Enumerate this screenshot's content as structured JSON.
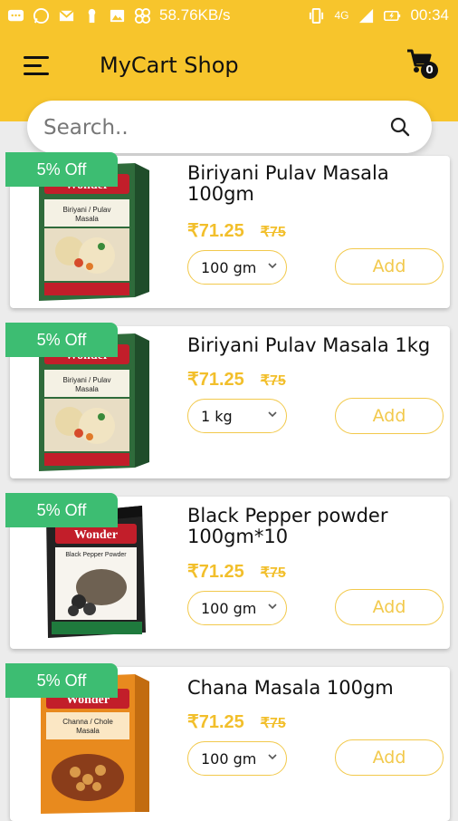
{
  "statusbar": {
    "speed": "58.76KB/s",
    "network": "4G",
    "time": "00:34",
    "icons": [
      "message-icon",
      "whatsapp-icon",
      "gmail-icon",
      "keyhole-icon",
      "gallery-icon",
      "fan-icon",
      "vibrate-icon",
      "signal-icon",
      "battery-icon"
    ]
  },
  "appbar": {
    "title": "MyCart Shop",
    "cart_count": "0",
    "color": "#f7c52c"
  },
  "search": {
    "placeholder": "Search.."
  },
  "products": [
    {
      "discount": "5% Off",
      "name": "Biriyani Pulav Masala 100gm",
      "price": "₹71.25",
      "mrp": "₹75",
      "size": "100 gm",
      "add_label": "Add",
      "image": "biriyani-pulav-masala-pack"
    },
    {
      "discount": "5% Off",
      "name": "Biriyani Pulav Masala 1kg",
      "price": "₹71.25",
      "mrp": "₹75",
      "size": "1 kg",
      "add_label": "Add",
      "image": "biriyani-pulav-masala-pack"
    },
    {
      "discount": "5% Off",
      "name": "Black Pepper powder 100gm*10",
      "price": "₹71.25",
      "mrp": "₹75",
      "size": "100 gm",
      "add_label": "Add",
      "image": "black-pepper-powder-pack"
    },
    {
      "discount": "5% Off",
      "name": "Chana Masala 100gm",
      "price": "₹71.25",
      "mrp": "₹75",
      "size": "100 gm",
      "add_label": "Add",
      "image": "chana-masala-pack"
    }
  ],
  "packaging": {
    "brand": "Wonder",
    "biriyani_label": "Biriyani / Pulav Masala",
    "pepper_label": "Black Pepper Powder",
    "chana_label": "Channa / Chole Masala"
  },
  "colors": {
    "accent": "#f7c52c",
    "discount": "#3dbd72",
    "price": "#f2bf2b"
  }
}
